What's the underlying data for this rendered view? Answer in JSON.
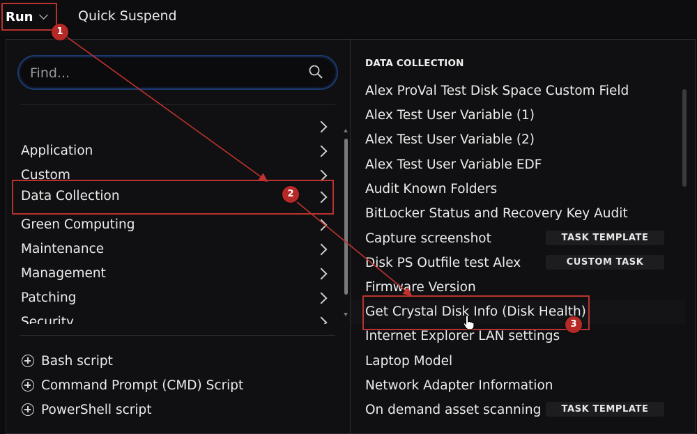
{
  "toolbar": {
    "run_label": "Run",
    "quick_suspend_label": "Quick Suspend"
  },
  "search": {
    "placeholder": "Find..."
  },
  "categories": [
    {
      "label": ""
    },
    {
      "label": "Application"
    },
    {
      "label": "Custom"
    },
    {
      "label": "Data Collection",
      "selected": true
    },
    {
      "label": "Green Computing"
    },
    {
      "label": "Maintenance"
    },
    {
      "label": "Management"
    },
    {
      "label": "Patching"
    },
    {
      "label": "Security"
    }
  ],
  "script_types": [
    {
      "label": "Bash script"
    },
    {
      "label": "Command Prompt (CMD) Script"
    },
    {
      "label": "PowerShell script"
    }
  ],
  "section": {
    "heading": "DATA COLLECTION",
    "items": [
      {
        "label": "Alex ProVal Test Disk Space Custom Field"
      },
      {
        "label": "Alex Test User Variable (1)"
      },
      {
        "label": "Alex Test User Variable (2)"
      },
      {
        "label": "Alex Test User Variable EDF"
      },
      {
        "label": "Audit Known Folders"
      },
      {
        "label": "BitLocker Status and Recovery Key Audit"
      },
      {
        "label": "Capture screenshot",
        "badge": "TASK TEMPLATE"
      },
      {
        "label": "Disk PS Outfile test Alex",
        "badge": "CUSTOM TASK"
      },
      {
        "label": "Firmware Version"
      },
      {
        "label": "Get Crystal Disk Info (Disk Health)",
        "highlighted": true
      },
      {
        "label": "Internet Explorer LAN settings"
      },
      {
        "label": "Laptop Model"
      },
      {
        "label": "Network Adapter Information"
      },
      {
        "label": "On demand asset scanning (...",
        "badge": "TASK TEMPLATE"
      }
    ]
  },
  "callouts": [
    "1",
    "2",
    "3"
  ],
  "colors": {
    "accent_red": "#b8332f",
    "background": "#101012",
    "search_border": "#1c3a70"
  }
}
